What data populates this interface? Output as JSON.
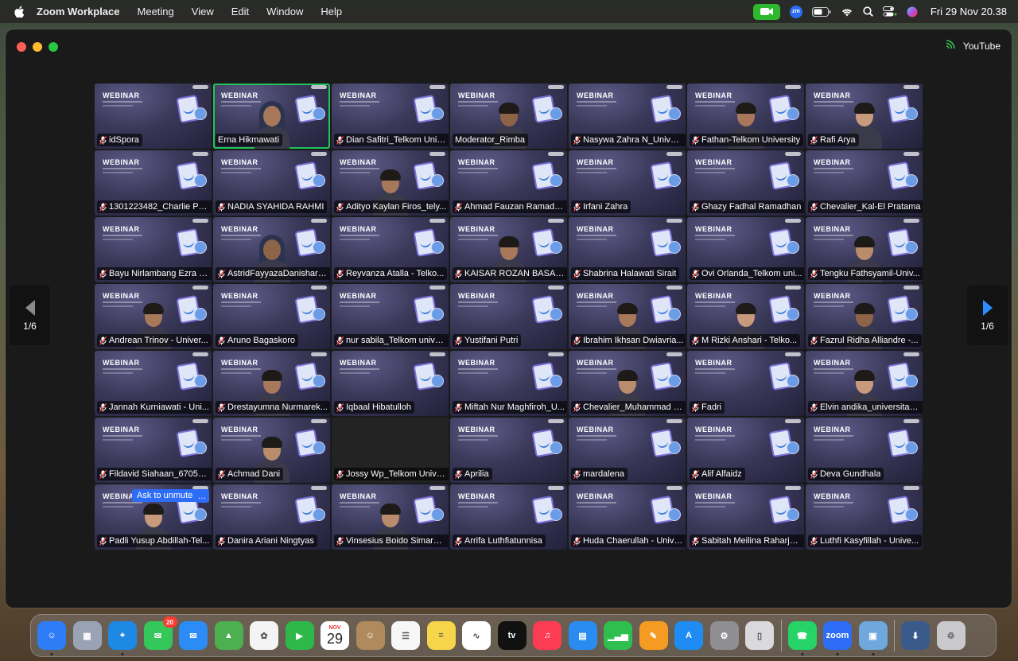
{
  "menubar": {
    "app_name": "Zoom Workplace",
    "items": [
      "Meeting",
      "View",
      "Edit",
      "Window",
      "Help"
    ],
    "clock": "Fri 29 Nov  20.38",
    "zoom_badge": "zm"
  },
  "window": {
    "share_label": "YouTube",
    "page_left": "1/6",
    "page_right": "1/6",
    "tile_banner": "WEBINAR",
    "unmute_prompt": "Ask to unmute",
    "more_label": "…"
  },
  "participants": [
    {
      "name": "idSpora",
      "muted": true,
      "video": false
    },
    {
      "name": "Erna Hikmawati",
      "muted": false,
      "video": true,
      "active": true
    },
    {
      "name": "Dian Safitri_Telkom Univ...",
      "muted": true,
      "video": false
    },
    {
      "name": "Moderator_Rimba",
      "muted": false,
      "video": true
    },
    {
      "name": "Nasywa Zahra N_Univer...",
      "muted": true,
      "video": false
    },
    {
      "name": "Fathan-Telkom University",
      "muted": true,
      "video": true
    },
    {
      "name": "Rafi Arya",
      "muted": true,
      "video": true
    },
    {
      "name": "1301223482_Charlie Pe...",
      "muted": true,
      "video": false
    },
    {
      "name": "NADIA SYAHIDA RAHMI",
      "muted": true,
      "video": false
    },
    {
      "name": "Adityo Kaylan Firos_tely...",
      "muted": true,
      "video": true
    },
    {
      "name": "Ahmad Fauzan Ramadh...",
      "muted": true,
      "video": false
    },
    {
      "name": "Irfani Zahra",
      "muted": true,
      "video": false
    },
    {
      "name": "Ghazy Fadhal Ramadhan",
      "muted": true,
      "video": false
    },
    {
      "name": "Chevalier_Kal-El Pratama",
      "muted": true,
      "video": false
    },
    {
      "name": "Bayu Nirlambang Ezra K...",
      "muted": true,
      "video": false
    },
    {
      "name": "AstridFayyazaDanishara...",
      "muted": true,
      "video": true
    },
    {
      "name": "Reyvanza Atalla - Telko...",
      "muted": true,
      "video": false
    },
    {
      "name": "KAISAR ROZAN BASALI...",
      "muted": true,
      "video": true
    },
    {
      "name": "Shabrina Halawati Sirait",
      "muted": true,
      "video": false
    },
    {
      "name": "Ovi Orlanda_Telkom uni...",
      "muted": true,
      "video": false
    },
    {
      "name": "Tengku Fathsyamil-Univ...",
      "muted": true,
      "video": true
    },
    {
      "name": "Andrean Trinov - Univer...",
      "muted": true,
      "video": true
    },
    {
      "name": "Aruno Bagaskoro",
      "muted": true,
      "video": false
    },
    {
      "name": "nur sabila_Telkom unive...",
      "muted": true,
      "video": false
    },
    {
      "name": "Yustifani Putri",
      "muted": true,
      "video": false
    },
    {
      "name": "Ibrahim Ikhsan Dwiavria...",
      "muted": true,
      "video": true
    },
    {
      "name": "M Rizki Anshari - Telko...",
      "muted": true,
      "video": true
    },
    {
      "name": "Fazrul Ridha Alliandre -...",
      "muted": true,
      "video": true
    },
    {
      "name": "Jannah Kurniawati - Uni...",
      "muted": true,
      "video": false
    },
    {
      "name": "Drestayumna Nurmarek...",
      "muted": true,
      "video": true
    },
    {
      "name": "Iqbaal Hibatulloh",
      "muted": true,
      "video": false
    },
    {
      "name": "Miftah Nur Maghfiroh_U...",
      "muted": true,
      "video": false
    },
    {
      "name": "Chevalier_Muhammad N...",
      "muted": true,
      "video": true
    },
    {
      "name": "Fadri",
      "muted": true,
      "video": false
    },
    {
      "name": "Elvin andika_universitas...",
      "muted": true,
      "video": true
    },
    {
      "name": "Fildavid Siahaan_67052...",
      "muted": true,
      "video": false
    },
    {
      "name": "Achmad Dani",
      "muted": true,
      "video": true
    },
    {
      "name": "Jossy Wp_Telkom Unive...",
      "muted": true,
      "video": false,
      "blank": true
    },
    {
      "name": "Aprilia",
      "muted": true,
      "video": false
    },
    {
      "name": "mardalena",
      "muted": true,
      "video": false
    },
    {
      "name": "Alif Alfaidz",
      "muted": true,
      "video": false
    },
    {
      "name": "Deva Gundhala",
      "muted": true,
      "video": false
    },
    {
      "name": "Padli Yusup Abdillah-Tel...",
      "muted": true,
      "video": true,
      "unmute_prompt": true
    },
    {
      "name": "Danira Ariani Ningtyas",
      "muted": true,
      "video": false
    },
    {
      "name": "Vinsesius Boido Simarm...",
      "muted": true,
      "video": true
    },
    {
      "name": "Arrifa Luthfiatunnisa",
      "muted": true,
      "video": false
    },
    {
      "name": "Huda Chaerullah - Unive...",
      "muted": true,
      "video": false
    },
    {
      "name": "Sabitah Meilina Raharjo_...",
      "muted": true,
      "video": false
    },
    {
      "name": "Luthfi Kasyfillah - Unive...",
      "muted": true,
      "video": false
    }
  ],
  "dock": {
    "apps": [
      {
        "icon": "finder-icon",
        "bg": "#2f7df6",
        "glyph": "☺",
        "running": true
      },
      {
        "icon": "launchpad-icon",
        "bg": "#9aa3b5",
        "glyph": "▦"
      },
      {
        "icon": "safari-icon",
        "bg": "#1e88e5",
        "glyph": "⌖",
        "running": true
      },
      {
        "icon": "messages-icon",
        "bg": "#34c759",
        "glyph": "✉",
        "badge": "20"
      },
      {
        "icon": "mail-icon",
        "bg": "#2b8cf5",
        "glyph": "✉"
      },
      {
        "icon": "maps-icon",
        "bg": "#4caf50",
        "glyph": "▲"
      },
      {
        "icon": "photos-icon",
        "bg": "#f4f4f4",
        "glyph": "✿"
      },
      {
        "icon": "facetime-icon",
        "bg": "#2fb84a",
        "glyph": "▶"
      },
      {
        "icon": "calendar-icon",
        "bg": "#ffffff",
        "month": "NOV",
        "day": "29",
        "calendar": true
      },
      {
        "icon": "contacts-icon",
        "bg": "#b08a5c",
        "glyph": "☺"
      },
      {
        "icon": "reminders-icon",
        "bg": "#f7f7f7",
        "glyph": "☰"
      },
      {
        "icon": "notes-icon",
        "bg": "#f7d54a",
        "glyph": "≡"
      },
      {
        "icon": "freeform-icon",
        "bg": "#ffffff",
        "glyph": "∿"
      },
      {
        "icon": "appletv-icon",
        "bg": "#111111",
        "glyph": "tv"
      },
      {
        "icon": "music-icon",
        "bg": "#fc3c53",
        "glyph": "♫"
      },
      {
        "icon": "keynote-icon",
        "bg": "#2a8cf0",
        "glyph": "▤"
      },
      {
        "icon": "numbers-icon",
        "bg": "#2fbf4e",
        "glyph": "▁▃▅"
      },
      {
        "icon": "pages-icon",
        "bg": "#f59a23",
        "glyph": "✎"
      },
      {
        "icon": "appstore-icon",
        "bg": "#1e8cf2",
        "glyph": "A"
      },
      {
        "icon": "systemsettings-icon",
        "bg": "#8e8e93",
        "glyph": "⚙"
      },
      {
        "icon": "iphone-mirroring-icon",
        "bg": "#d9d9de",
        "glyph": "▯"
      },
      {
        "separator": true
      },
      {
        "icon": "whatsapp-icon",
        "bg": "#25d366",
        "glyph": "☎",
        "running": true
      },
      {
        "icon": "zoom-icon",
        "bg": "#2d6df6",
        "glyph": "zoom",
        "running": true
      },
      {
        "icon": "preview-icon",
        "bg": "#6fa8dc",
        "glyph": "▣",
        "running": true
      },
      {
        "separator": true
      },
      {
        "icon": "downloads-icon",
        "bg": "#3a5a8c",
        "glyph": "⬇"
      },
      {
        "icon": "trash-icon",
        "bg": "#c9c9cc",
        "glyph": "♲"
      }
    ]
  }
}
